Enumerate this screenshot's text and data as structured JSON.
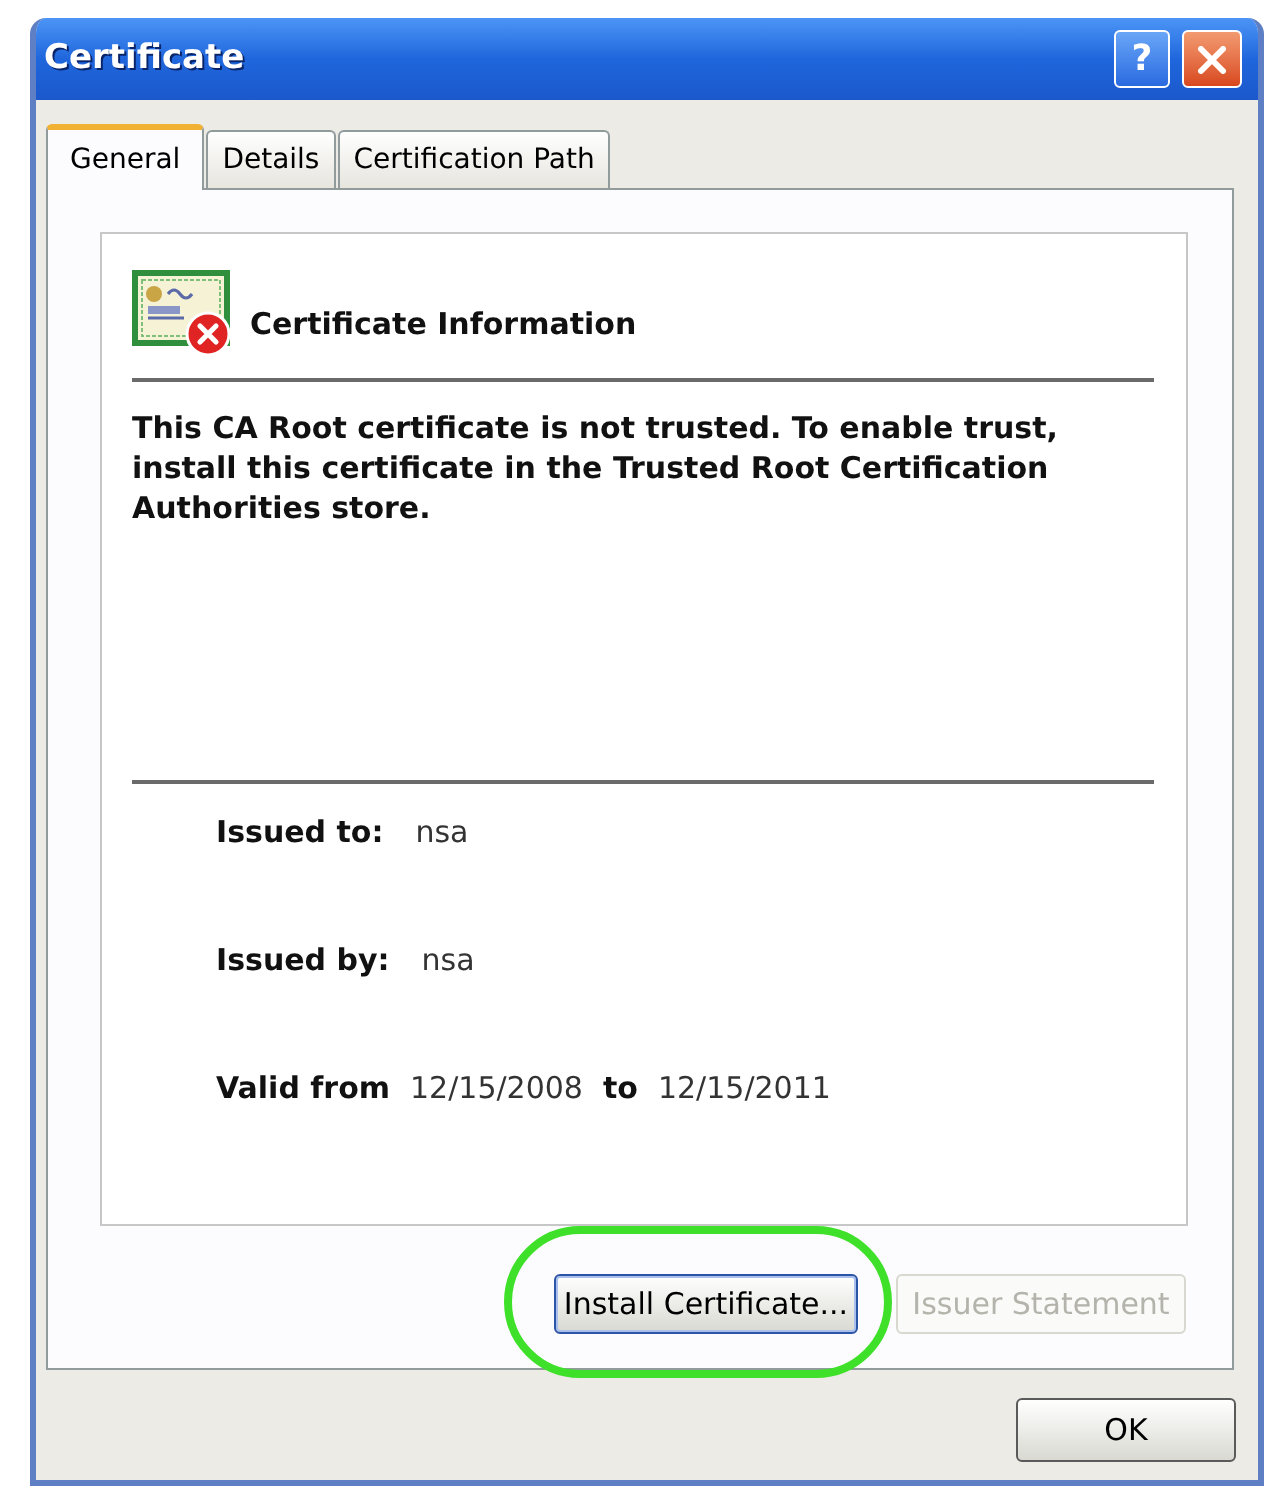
{
  "window": {
    "title": "Certificate",
    "title_buttons": [
      {
        "kind": "help",
        "label": "?"
      },
      {
        "kind": "close"
      }
    ]
  },
  "tabs": [
    {
      "label": "General",
      "selected": true
    },
    {
      "label": "Details",
      "selected": false
    },
    {
      "label": "Certification Path",
      "selected": false
    }
  ],
  "certificate_info": {
    "heading": "Certificate Information",
    "trusted": false,
    "message": "This CA Root certificate is not trusted. To enable trust, install this certificate in the Trusted Root Certification Authorities store.",
    "fields": [
      {
        "label": "Issued to:",
        "value": "nsa"
      },
      {
        "label": "Issued by:",
        "value": "nsa"
      }
    ],
    "validity": {
      "label": "Valid from",
      "from": "12/15/2008",
      "to_label": "to",
      "to": "12/15/2011"
    }
  },
  "buttons": [
    {
      "label": "Install Certificate...",
      "focused": true,
      "disabled": false,
      "highlighted": true
    },
    {
      "label": "Issuer Statement",
      "focused": false,
      "disabled": true,
      "highlighted": false
    }
  ],
  "footer_buttons": [
    {
      "label": "OK"
    }
  ]
}
